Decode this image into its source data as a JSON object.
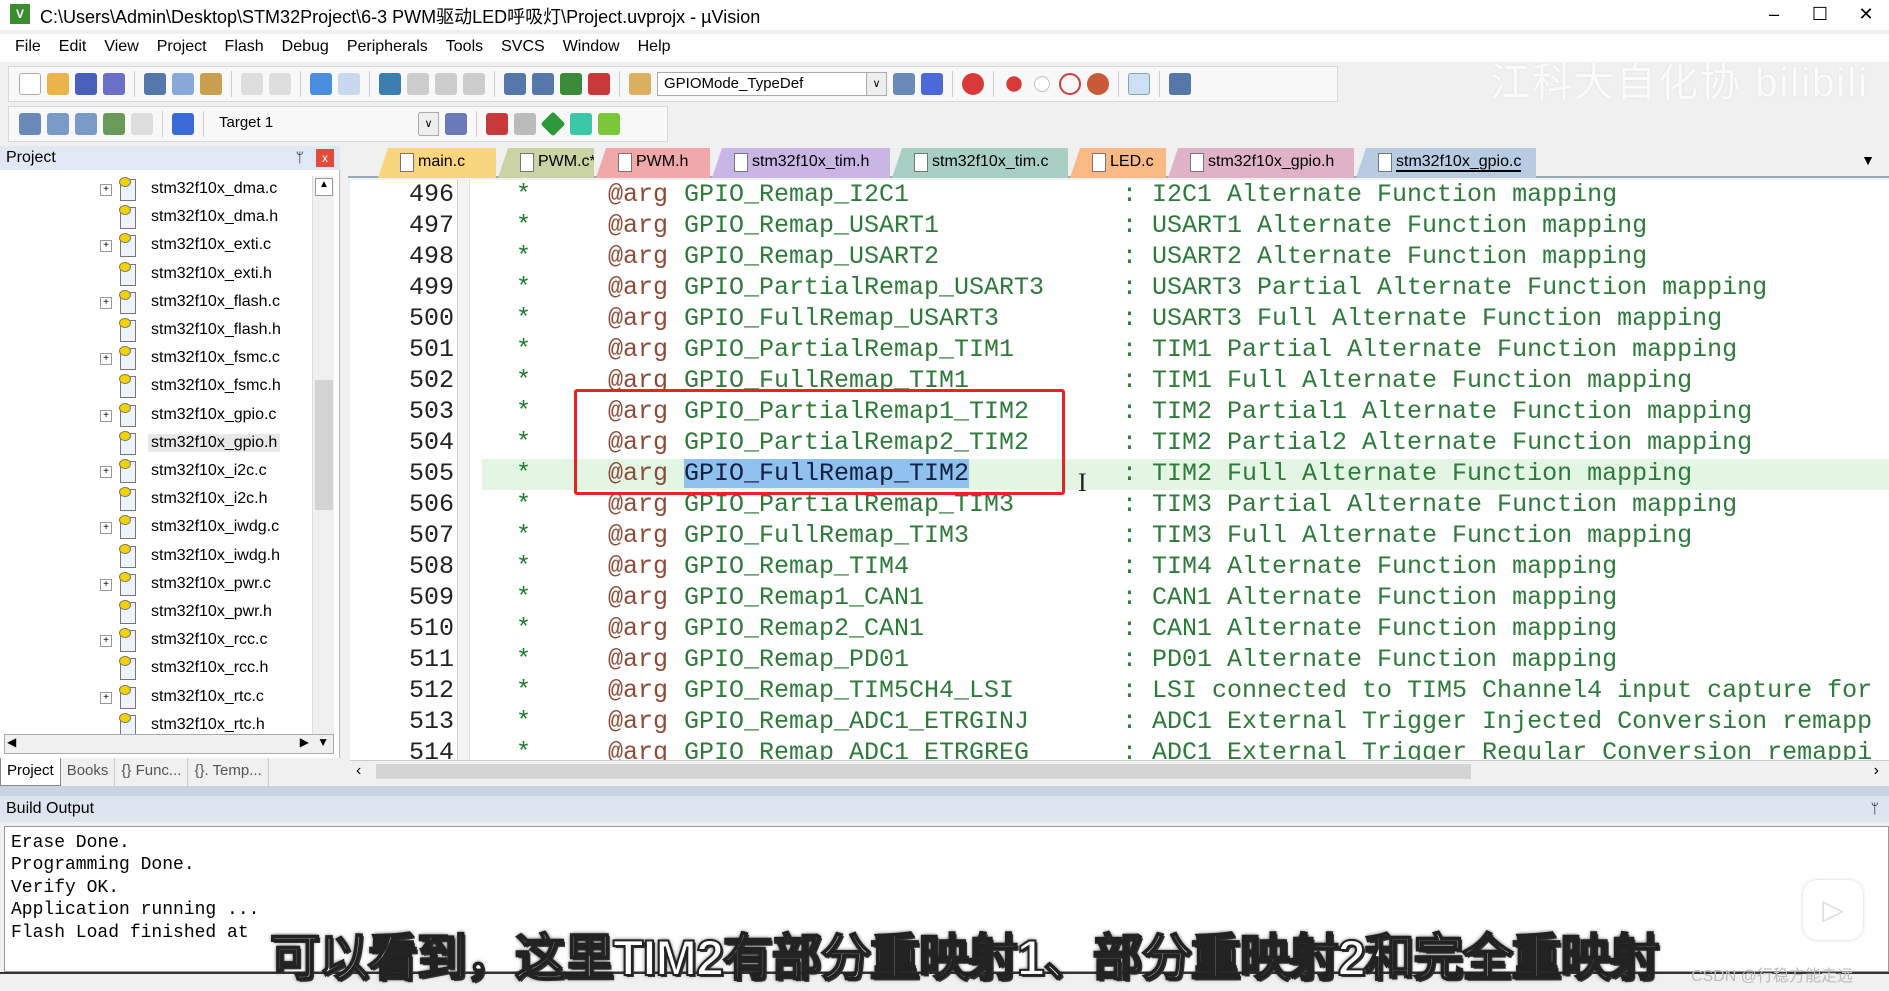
{
  "window": {
    "title": "C:\\Users\\Admin\\Desktop\\STM32Project\\6-3 PWM驱动LED呼吸灯\\Project.uvprojx - µVision",
    "minimize": "–",
    "maximize": "☐",
    "close": "✕"
  },
  "menu": [
    "File",
    "Edit",
    "View",
    "Project",
    "Flash",
    "Debug",
    "Peripherals",
    "Tools",
    "SVCS",
    "Window",
    "Help"
  ],
  "toolbar": {
    "find_combo": "GPIOMode_TypeDef",
    "target_combo": "Target 1"
  },
  "watermark": "江科大自化协 bilibili",
  "project_panel": {
    "title": "Project",
    "pin": "ᛘ",
    "close": "x",
    "items": [
      {
        "label": "stm32f10x_dma.c",
        "expandable": true
      },
      {
        "label": "stm32f10x_dma.h",
        "expandable": false
      },
      {
        "label": "stm32f10x_exti.c",
        "expandable": true
      },
      {
        "label": "stm32f10x_exti.h",
        "expandable": false
      },
      {
        "label": "stm32f10x_flash.c",
        "expandable": true
      },
      {
        "label": "stm32f10x_flash.h",
        "expandable": false
      },
      {
        "label": "stm32f10x_fsmc.c",
        "expandable": true
      },
      {
        "label": "stm32f10x_fsmc.h",
        "expandable": false
      },
      {
        "label": "stm32f10x_gpio.c",
        "expandable": true
      },
      {
        "label": "stm32f10x_gpio.h",
        "expandable": false,
        "selected": true
      },
      {
        "label": "stm32f10x_i2c.c",
        "expandable": true
      },
      {
        "label": "stm32f10x_i2c.h",
        "expandable": false
      },
      {
        "label": "stm32f10x_iwdg.c",
        "expandable": true
      },
      {
        "label": "stm32f10x_iwdg.h",
        "expandable": false
      },
      {
        "label": "stm32f10x_pwr.c",
        "expandable": true
      },
      {
        "label": "stm32f10x_pwr.h",
        "expandable": false
      },
      {
        "label": "stm32f10x_rcc.c",
        "expandable": true
      },
      {
        "label": "stm32f10x_rcc.h",
        "expandable": false
      },
      {
        "label": "stm32f10x_rtc.c",
        "expandable": true
      },
      {
        "label": "stm32f10x_rtc.h",
        "expandable": false
      }
    ],
    "tabs": [
      "Project",
      "Books",
      "{} Func...",
      "{}. Temp..."
    ]
  },
  "editor_tabs": [
    {
      "label": "main.c",
      "color": "#f9d57e"
    },
    {
      "label": "PWM.c*",
      "color": "#c9d3a4"
    },
    {
      "label": "PWM.h",
      "color": "#f0a8a8"
    },
    {
      "label": "stm32f10x_tim.h",
      "color": "#c9b6e4"
    },
    {
      "label": "stm32f10x_tim.c",
      "color": "#a9cfc4"
    },
    {
      "label": "LED.c",
      "color": "#f8b985"
    },
    {
      "label": "stm32f10x_gpio.h",
      "color": "#e0b2c8"
    },
    {
      "label": "stm32f10x_gpio.c",
      "color": "#b7cce0",
      "active": true
    }
  ],
  "code_lines": [
    {
      "n": "496",
      "star": "*",
      "kw": "@arg",
      "name": "GPIO_Remap_I2C1",
      "desc": ": I2C1 Alternate Function mapping"
    },
    {
      "n": "497",
      "star": "*",
      "kw": "@arg",
      "name": "GPIO_Remap_USART1",
      "desc": ": USART1 Alternate Function mapping"
    },
    {
      "n": "498",
      "star": "*",
      "kw": "@arg",
      "name": "GPIO_Remap_USART2",
      "desc": ": USART2 Alternate Function mapping"
    },
    {
      "n": "499",
      "star": "*",
      "kw": "@arg",
      "name": "GPIO_PartialRemap_USART3",
      "desc": ": USART3 Partial Alternate Function mapping"
    },
    {
      "n": "500",
      "star": "*",
      "kw": "@arg",
      "name": "GPIO_FullRemap_USART3",
      "desc": ": USART3 Full Alternate Function mapping"
    },
    {
      "n": "501",
      "star": "*",
      "kw": "@arg",
      "name": "GPIO_PartialRemap_TIM1",
      "desc": ": TIM1 Partial Alternate Function mapping"
    },
    {
      "n": "502",
      "star": "*",
      "kw": "@arg",
      "name": "GPIO_FullRemap_TIM1",
      "desc": ": TIM1 Full Alternate Function mapping"
    },
    {
      "n": "503",
      "star": "*",
      "kw": "@arg",
      "name": "GPIO_PartialRemap1_TIM2",
      "desc": ": TIM2 Partial1 Alternate Function mapping"
    },
    {
      "n": "504",
      "star": "*",
      "kw": "@arg",
      "name": "GPIO_PartialRemap2_TIM2",
      "desc": ": TIM2 Partial2 Alternate Function mapping"
    },
    {
      "n": "505",
      "star": "*",
      "kw": "@arg",
      "name": "GPIO_FullRemap_TIM2",
      "desc": ": TIM2 Full Alternate Function mapping",
      "current": true,
      "selected": true
    },
    {
      "n": "506",
      "star": "*",
      "kw": "@arg",
      "name": "GPIO_PartialRemap_TIM3",
      "desc": ": TIM3 Partial Alternate Function mapping"
    },
    {
      "n": "507",
      "star": "*",
      "kw": "@arg",
      "name": "GPIO_FullRemap_TIM3",
      "desc": ": TIM3 Full Alternate Function mapping"
    },
    {
      "n": "508",
      "star": "*",
      "kw": "@arg",
      "name": "GPIO_Remap_TIM4",
      "desc": ": TIM4 Alternate Function mapping"
    },
    {
      "n": "509",
      "star": "*",
      "kw": "@arg",
      "name": "GPIO_Remap1_CAN1",
      "desc": ": CAN1 Alternate Function mapping"
    },
    {
      "n": "510",
      "star": "*",
      "kw": "@arg",
      "name": "GPIO_Remap2_CAN1",
      "desc": ": CAN1 Alternate Function mapping"
    },
    {
      "n": "511",
      "star": "*",
      "kw": "@arg",
      "name": "GPIO_Remap_PD01",
      "desc": ": PD01 Alternate Function mapping"
    },
    {
      "n": "512",
      "star": "*",
      "kw": "@arg",
      "name": "GPIO_Remap_TIM5CH4_LSI",
      "desc": ": LSI connected to TIM5 Channel4 input capture for"
    },
    {
      "n": "513",
      "star": "*",
      "kw": "@arg",
      "name": "GPIO_Remap_ADC1_ETRGINJ",
      "desc": ": ADC1 External Trigger Injected Conversion remapp"
    },
    {
      "n": "514",
      "star": "*",
      "kw": "@arg",
      "name": "GPIO_Remap_ADC1_ETRGREG",
      "desc": ": ADC1 External Trigger Regular Conversion remappi"
    }
  ],
  "build_output": {
    "title": "Build Output",
    "pin": "ᛘ",
    "lines": [
      "Erase Done.",
      "Programming Done.",
      "Verify OK.",
      "Application running ...",
      "Flash Load finished at"
    ]
  },
  "subtitle": "可以看到，这里TIM2有部分重映射1、部分重映射2和完全重映射",
  "csdn_watermark": "CSDN @行稳方能走远",
  "colors": {
    "comment": "#2d7a3a",
    "keyword": "#8a4b37",
    "highlight_line": "#e3f6e3",
    "selection": "#8fc0ee",
    "annotation_box": "#f02020"
  }
}
